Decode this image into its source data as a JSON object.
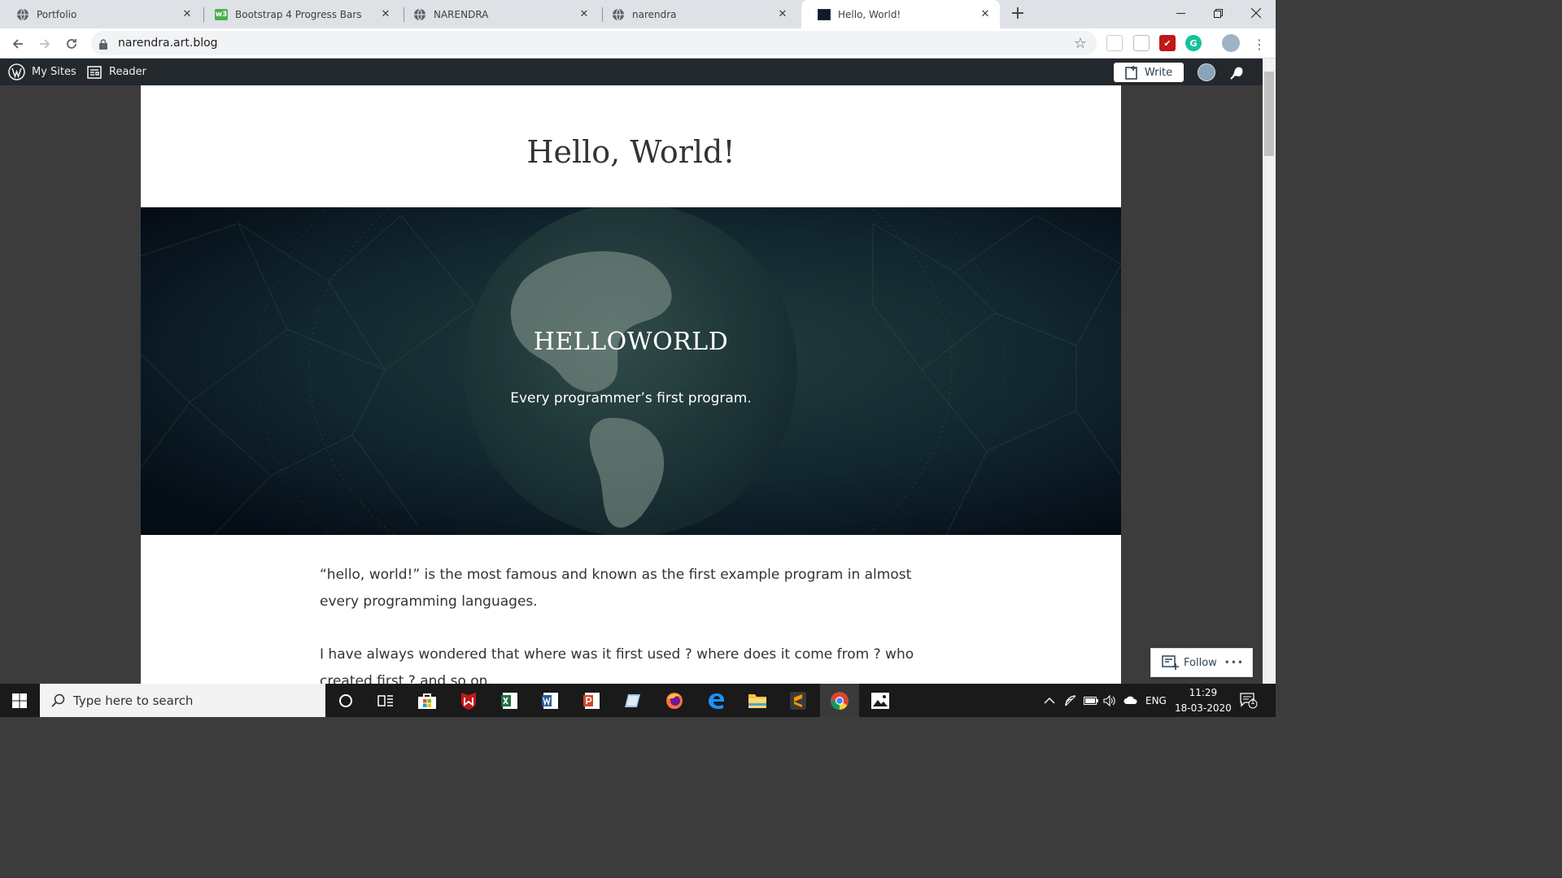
{
  "browser": {
    "tabs": [
      {
        "title": "Portfolio",
        "icon": "globe-icon"
      },
      {
        "title": "Bootstrap 4 Progress Bars",
        "icon": "w3schools-icon"
      },
      {
        "title": "NARENDRA",
        "icon": "globe-icon"
      },
      {
        "title": "narendra",
        "icon": "globe-icon"
      },
      {
        "title": "Hello, World!",
        "icon": "site-thumbnail-icon",
        "active": true
      }
    ],
    "new_tab_label": "+",
    "url": "narendra.art.blog",
    "w3_badge": "w3",
    "extension_badge": "G"
  },
  "wp_bar": {
    "my_sites": "My Sites",
    "reader": "Reader",
    "write": "Write"
  },
  "post": {
    "title": "Hello, World!",
    "hero_title": "HELLOWORLD",
    "hero_subtitle": "Every programmer’s first program.",
    "paragraphs": [
      "“hello, world!” is the most famous and known as the first example program in almost every programming languages.",
      "I have always wondered that where was it first used ? where does it come from ? who created first ? and so on."
    ]
  },
  "follow": {
    "label": "Follow",
    "more": "•••"
  },
  "taskbar": {
    "search_placeholder": "Type here to search",
    "lang": "ENG",
    "time": "11:29",
    "date": "18-03-2020",
    "notifications_count": "1"
  },
  "colors": {
    "wp_bar": "#23282d",
    "tab_strip": "#dee1e6",
    "taskbar": "#1a1a1a"
  }
}
